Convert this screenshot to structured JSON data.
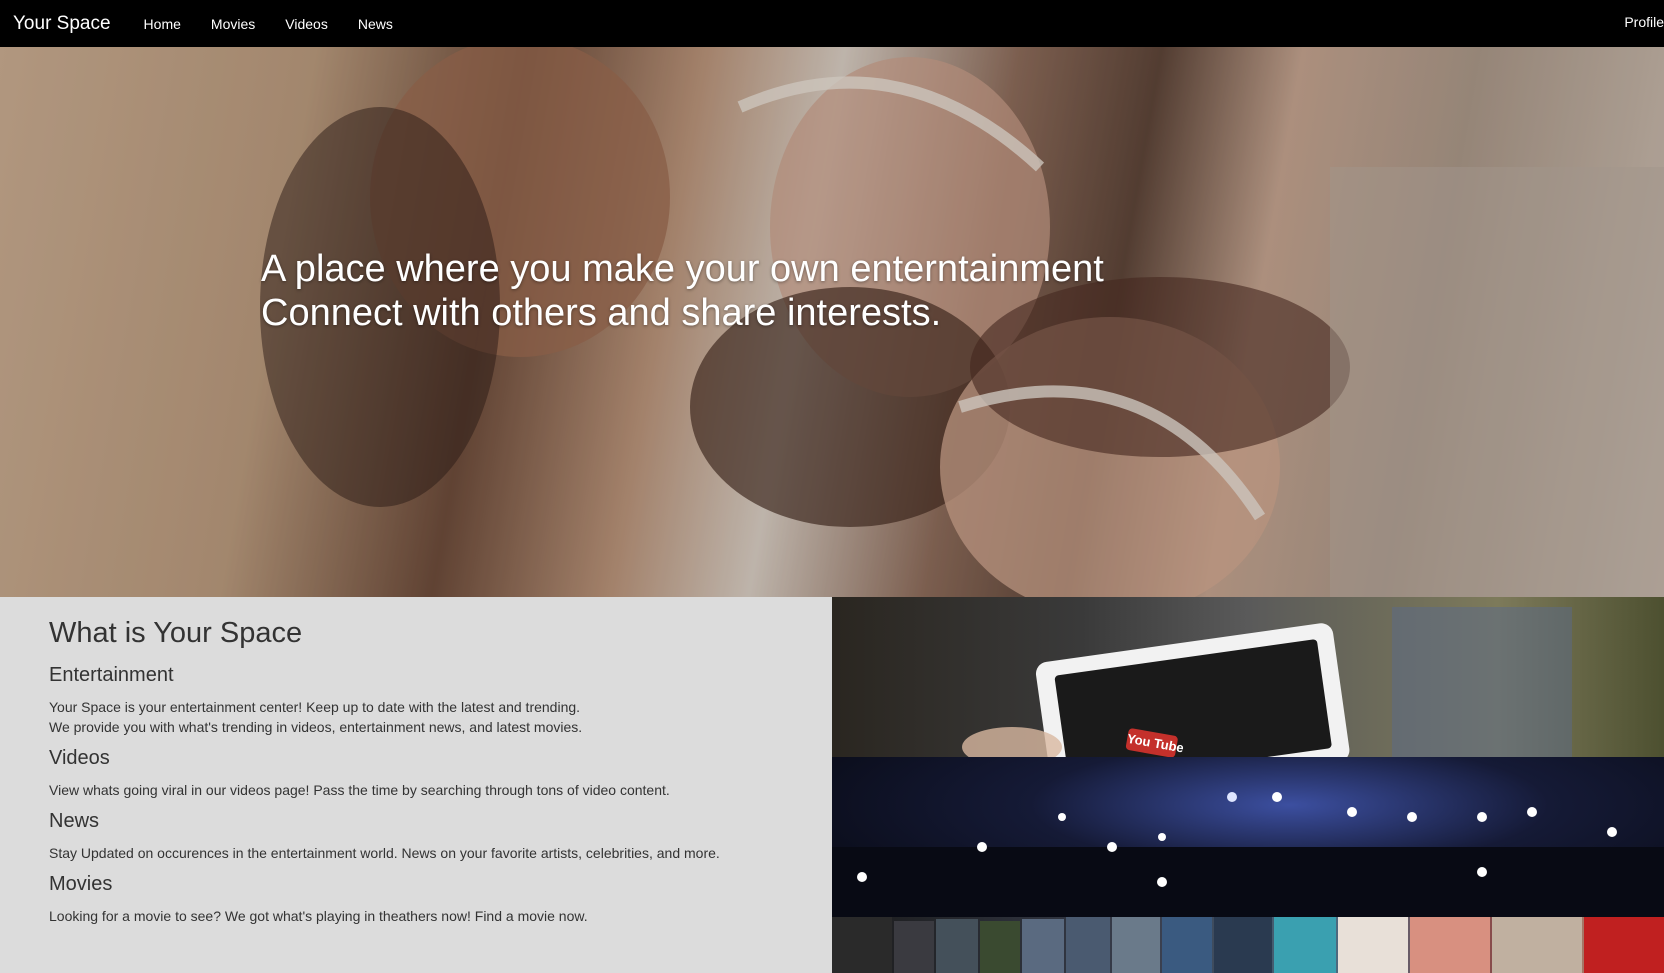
{
  "nav": {
    "brand": "Your Space",
    "links": [
      "Home",
      "Movies",
      "Videos",
      "News"
    ],
    "profile": "Profile"
  },
  "hero": {
    "line1": "A place where you make your own enterntainment",
    "line2": "Connect with others and share interests."
  },
  "about": {
    "title": "What is Your Space",
    "sections": [
      {
        "heading": "Entertainment",
        "lines": [
          "Your Space is your entertainment center! Keep up to date with the latest and trending.",
          "We provide you with what's trending in videos, entertainment news, and latest movies."
        ]
      },
      {
        "heading": "Videos",
        "lines": [
          "View whats going viral in our videos page! Pass the time by searching through tons of video content."
        ]
      },
      {
        "heading": "News",
        "lines": [
          "Stay Updated on occurences in the entertainment world. News on your favorite artists, celebrities, and more."
        ]
      },
      {
        "heading": "Movies",
        "lines": [
          "Looking for a movie to see? We got what's playing in theathers now! Find a movie now."
        ]
      }
    ]
  },
  "gallery": {
    "youtube_logo": "You Tube"
  }
}
